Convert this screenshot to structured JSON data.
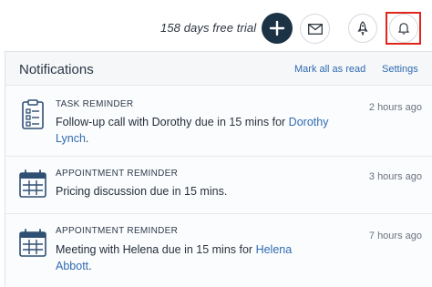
{
  "topbar": {
    "trial_text": "158 days free trial",
    "icons": {
      "add": "plus-icon",
      "mail": "envelope-icon",
      "rocket": "rocket-icon",
      "bell": "bell-icon"
    }
  },
  "panel": {
    "title": "Notifications",
    "mark_all_read": "Mark all as read",
    "settings": "Settings"
  },
  "notifications": [
    {
      "type": "TASK REMINDER",
      "icon": "clipboard-icon",
      "subject": "Follow-up call with Dorothy",
      "middle": " due in 15 mins for ",
      "link": "Dorothy Lynch",
      "end": ".",
      "time": "2 hours ago"
    },
    {
      "type": "APPOINTMENT REMINDER",
      "icon": "calendar-icon",
      "subject": "Pricing discussion",
      "middle": " due in 15 mins.",
      "link": "",
      "end": "",
      "time": "3 hours ago"
    },
    {
      "type": "APPOINTMENT REMINDER",
      "icon": "calendar-icon",
      "subject": "Meeting with Helena",
      "middle": " due in 15 mins for ",
      "link": "Helena Abbott",
      "end": ".",
      "time": "7 hours ago"
    }
  ],
  "colors": {
    "primary_dark": "#1c3345",
    "link": "#2f6bb0",
    "highlight": "#e0261b",
    "icon": "#2f4f73"
  }
}
